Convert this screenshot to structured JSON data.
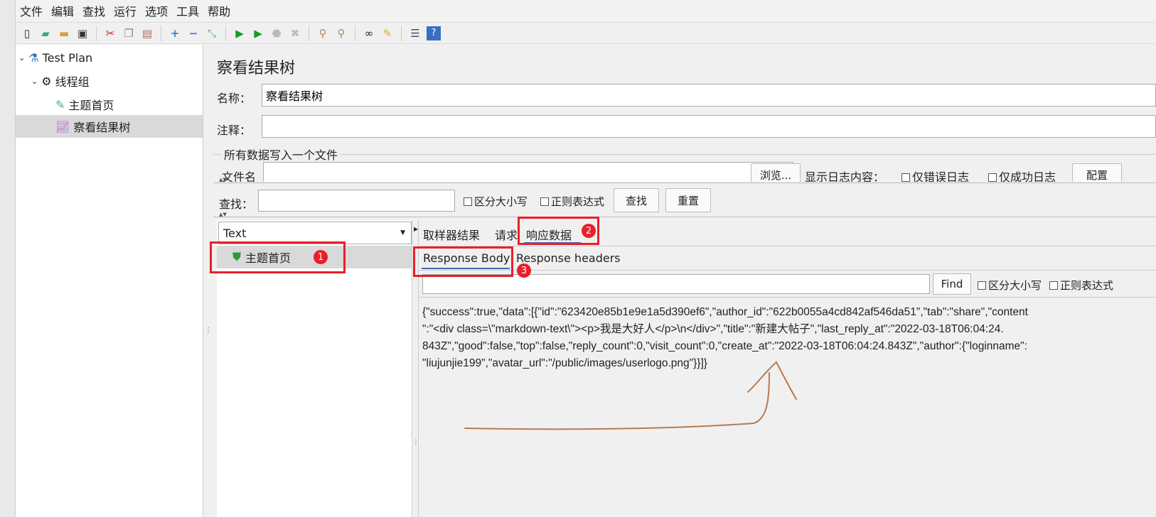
{
  "menu": [
    "文件",
    "编辑",
    "查找",
    "运行",
    "选项",
    "工具",
    "帮助"
  ],
  "toolbar_icons": [
    "new-icon",
    "templates-icon",
    "open-icon",
    "save-icon",
    "cut-icon",
    "copy-icon",
    "paste-icon",
    "expand-icon",
    "collapse-icon",
    "toggle-icon",
    "start-icon",
    "start-no-pause-icon",
    "stop-icon",
    "shutdown-icon",
    "clear-icon",
    "clear-all-icon",
    "search-icon",
    "reset-search-icon",
    "function-helper-icon",
    "help-icon"
  ],
  "tree": {
    "root": "Test Plan",
    "thread_group": "线程组",
    "sampler": "主题首页",
    "listener": "察看结果树"
  },
  "panel": {
    "title": "察看结果树",
    "name_label": "名称：",
    "name_value": "察看结果树",
    "comment_label": "注释：",
    "comment_value": "",
    "file_group": "所有数据写入一个文件",
    "filename_label": "文件名",
    "browse": "浏览...",
    "log_label": "显示日志内容：",
    "errors_only": "仅错误日志",
    "success_only": "仅成功日志",
    "configure": "配置",
    "search_label": "查找：",
    "case_sensitive": "区分大小写",
    "regex": "正则表达式",
    "find_btn": "查找",
    "reset_btn": "重置"
  },
  "results": {
    "renderer": "Text",
    "items": [
      "主题首页"
    ],
    "tabs": [
      "取样器结果",
      "请求",
      "响应数据"
    ],
    "subtabs": [
      "Response Body",
      "Response headers"
    ],
    "find_btn": "Find",
    "case_sensitive": "区分大小写",
    "regex": "正则表达式",
    "body_lines": [
      "{\"success\":true,\"data\":[{\"id\":\"623420e85b1e9e1a5d390ef6\",\"author_id\":\"622b0055a4cd842af546da51\",\"tab\":\"share\",\"content",
      "\":\"<div class=\\\"markdown-text\\\"><p>我是大好人</p>\\n</div>\",\"title\":\"新建大帖子\",\"last_reply_at\":\"2022-03-18T06:04:24.",
      "843Z\",\"good\":false,\"top\":false,\"reply_count\":0,\"visit_count\":0,\"create_at\":\"2022-03-18T06:04:24.843Z\",\"author\":{\"loginname\":",
      "\"liujunjie199\",\"avatar_url\":\"/public/images/userlogo.png\"}}]}"
    ]
  },
  "annotations": [
    "1",
    "2",
    "3"
  ],
  "colors": {
    "annotation_red": "#e8202a",
    "arrow": "#b87a50",
    "tab_underline": "#3d6fb6"
  }
}
